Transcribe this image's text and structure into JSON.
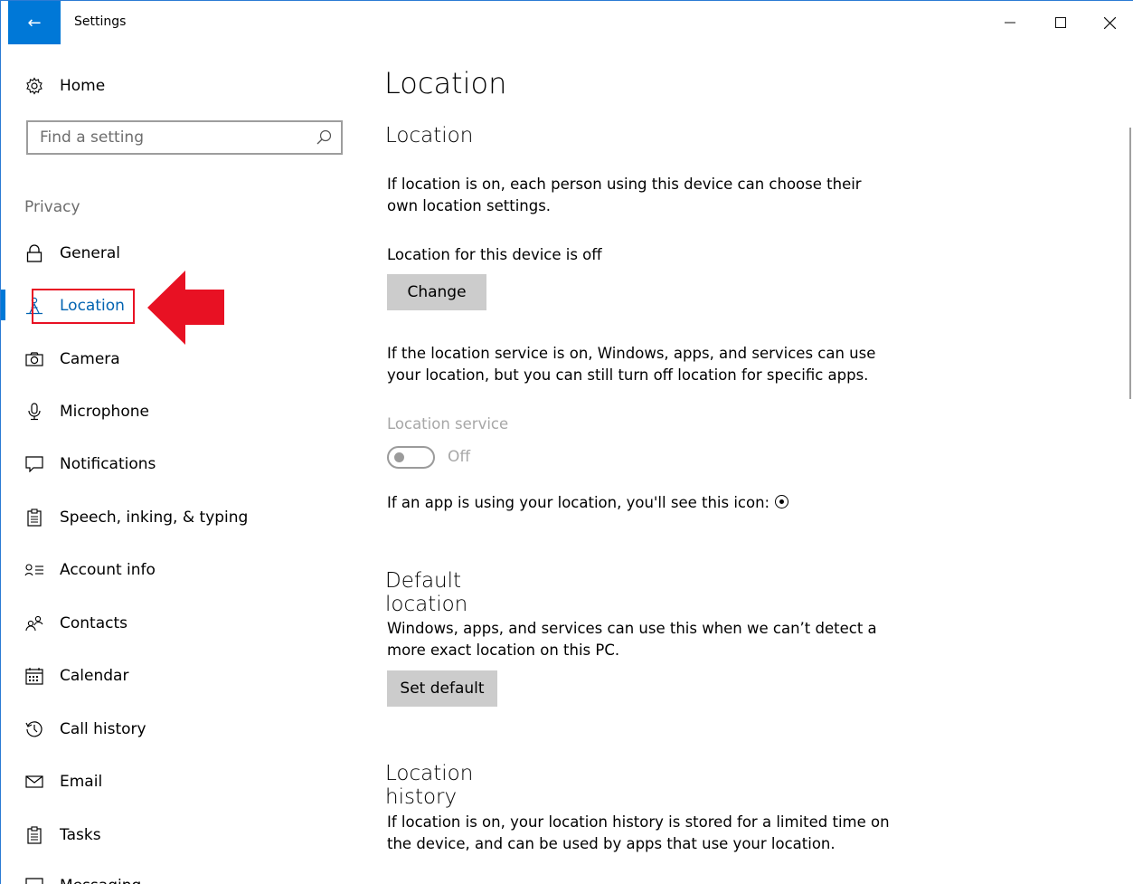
{
  "window": {
    "title": "Settings",
    "back_glyph": "←",
    "minimize_glyph": "—",
    "close_glyph": "✕"
  },
  "sidebar": {
    "home_label": "Home",
    "search_placeholder": "Find a setting",
    "group_label": "Privacy",
    "items": [
      {
        "label": "General",
        "icon": "lock-icon"
      },
      {
        "label": "Location",
        "icon": "location-person-icon",
        "active": true
      },
      {
        "label": "Camera",
        "icon": "camera-icon"
      },
      {
        "label": "Microphone",
        "icon": "microphone-icon"
      },
      {
        "label": "Notifications",
        "icon": "notification-icon"
      },
      {
        "label": "Speech, inking, & typing",
        "icon": "clipboard-icon"
      },
      {
        "label": "Account info",
        "icon": "account-info-icon"
      },
      {
        "label": "Contacts",
        "icon": "contacts-icon"
      },
      {
        "label": "Calendar",
        "icon": "calendar-icon"
      },
      {
        "label": "Call history",
        "icon": "history-icon"
      },
      {
        "label": "Email",
        "icon": "mail-icon"
      },
      {
        "label": "Tasks",
        "icon": "tasks-icon"
      },
      {
        "label": "Messaging",
        "icon": "message-icon"
      }
    ]
  },
  "main": {
    "page_title": "Location",
    "location_section": {
      "heading": "Location",
      "description": "If location is on, each person using this device can choose their own location settings.",
      "device_status": "Location for this device is off",
      "change_button": "Change",
      "service_description": "If the location service is on, Windows, apps, and services can use your location, but you can still turn off location for specific apps.",
      "service_label": "Location service",
      "service_state": "Off",
      "icon_note": "If an app is using your location, you'll see this icon:"
    },
    "default_location": {
      "heading": "Default location",
      "description": "Windows, apps, and services can use this when we can’t detect a more exact location on this PC.",
      "button": "Set default"
    },
    "location_history": {
      "heading": "Location history",
      "description": "If location is on, your location history is stored for a limited time on the device, and can be used by apps that use your location."
    }
  },
  "colors": {
    "accent": "#0078d7",
    "highlight": "#e81123"
  }
}
